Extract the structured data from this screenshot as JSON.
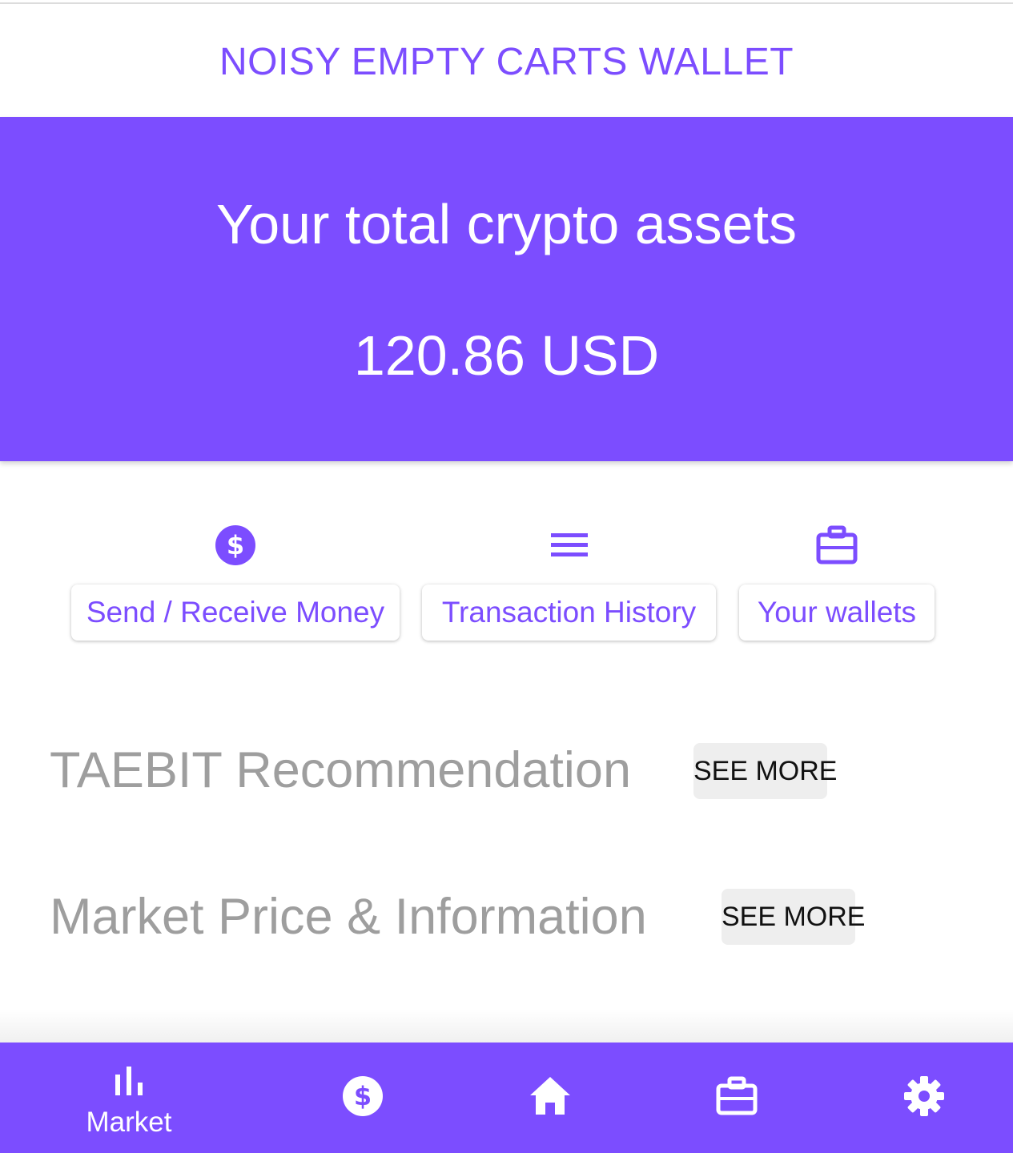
{
  "app": {
    "title": "NOISY EMPTY CARTS WALLET"
  },
  "hero": {
    "heading": "Your total crypto assets",
    "amount": "120.86 USD"
  },
  "actions": [
    {
      "icon": "dollar-circle-icon",
      "label": "Send / Receive Money"
    },
    {
      "icon": "list-icon",
      "label": "Transaction History"
    },
    {
      "icon": "briefcase-icon",
      "label": "Your wallets"
    }
  ],
  "sections": [
    {
      "title": "TAEBIT Recommendation",
      "button_label": "SEE MORE"
    },
    {
      "title": "Market Price & Information",
      "button_label": "SEE MORE"
    }
  ],
  "bottom_nav": [
    {
      "icon": "bar-chart-icon",
      "label": "Market",
      "active": true
    },
    {
      "icon": "dollar-circle-icon",
      "label": ""
    },
    {
      "icon": "home-icon",
      "label": ""
    },
    {
      "icon": "briefcase-icon",
      "label": ""
    },
    {
      "icon": "gear-icon",
      "label": ""
    }
  ],
  "colors": {
    "accent": "#7c4dff",
    "background": "#ffffff",
    "section_title": "#9e9e9e",
    "see_more_bg": "#eeeeee"
  }
}
